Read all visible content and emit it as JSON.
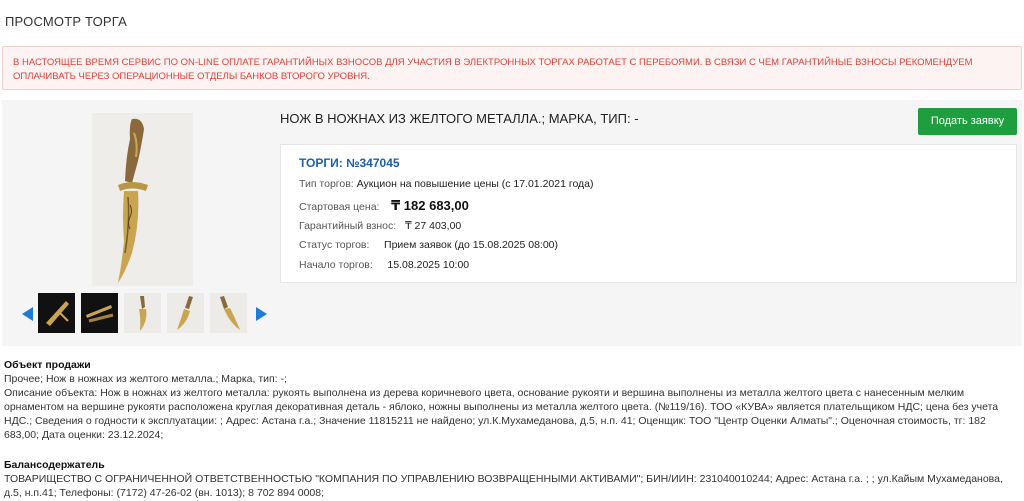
{
  "page": {
    "title": "ПРОСМОТР ТОРГА"
  },
  "alert": {
    "text": "В НАСТОЯЩЕЕ ВРЕМЯ СЕРВИС ПО ON-LINE ОПЛАТЕ ГАРАНТИЙНЫХ ВЗНОСОВ ДЛЯ УЧАСТИЯ В ЭЛЕКТРОННЫХ ТОРГАХ РАБОТАЕТ С ПЕРЕБОЯМИ. В СВЯЗИ С ЧЕМ ГАРАНТИЙНЫЕ ВЗНОСЫ РЕКОМЕНДУЕМ ОПЛАЧИВАТЬ ЧЕРЕЗ ОПЕРАЦИОННЫЕ ОТДЕЛЫ БАНКОВ ВТОРОГО УРОВНЯ.",
    "color": "#d9433b"
  },
  "lot": {
    "title": "НОЖ В НОЖНАХ ИЗ ЖЕЛТОГО МЕТАЛЛА.; МАРКА, ТИП: -",
    "apply_button": "Подать заявку",
    "auction_number": "ТОРГИ: №347045",
    "auction_type_label": "Тип торгов:",
    "auction_type_value": "Аукцион на повышение цены (с 17.01.2021 года)",
    "start_price_label": "Стартовая цена:",
    "start_price_value": "₸ 182 683,00",
    "deposit_label": "Гарантийный взнос:",
    "deposit_value": "₸ 27 403,00",
    "status_label": "Статус торгов:",
    "status_value": "Прием заявок (до 15.08.2025 08:00)",
    "start_label": "Начало торгов:",
    "start_value": "15.08.2025 10:00"
  },
  "gallery": {
    "prev_icon": "triangle-left",
    "next_icon": "triangle-right",
    "thumbnails": 5
  },
  "object": {
    "heading": "Объект продажи",
    "other": "Прочее; Нож в ножнах из желтого металла.; Марка, тип: -;",
    "description": "Описание объекта: Нож в ножнах из желтого металла: рукоять выполнена из дерева коричневого цвета, основание рукояти и вершина выполнены из металла желтого цвета с нанесенным мелким орнаментом на вершине рукояти расположена круглая декоративная деталь - яблоко, ножны выполнены из металла желтого цвета. (№119/16). ТОО «КУВА» является плательщиком НДС; цена без учета НДС.; Сведения о годности к эксплуатации: ; Адрес: Астана г.а.; Значение 11815211 не найдено; ул.К.Мухамеданова, д.5, н.п. 41; Оценщик: ТОО \"Центр Оценки Алматы\".; Оценочная стоимость, тг: 182 683,00; Дата оценки: 23.12.2024;"
  },
  "holder": {
    "heading": "Балансодержатель",
    "text": "ТОВАРИЩЕСТВО С ОГРАНИЧЕННОЙ ОТВЕТСТВЕННОСТЬЮ \"КОМПАНИЯ ПО УПРАВЛЕНИЮ ВОЗВРАЩЕННЫМИ АКТИВАМИ\"; БИН/ИИН: 231040010244; Адрес: Астана г.а. ; ; ул.Кайым Мухамеданова, д.5, н.п.41; Телефоны: (7172) 47-26-02 (вн. 1013); 8 702 894 0008;"
  },
  "colors": {
    "accent": "#1f5ea8",
    "button": "#1e9e3e",
    "arrows": "#1f7bd6"
  }
}
